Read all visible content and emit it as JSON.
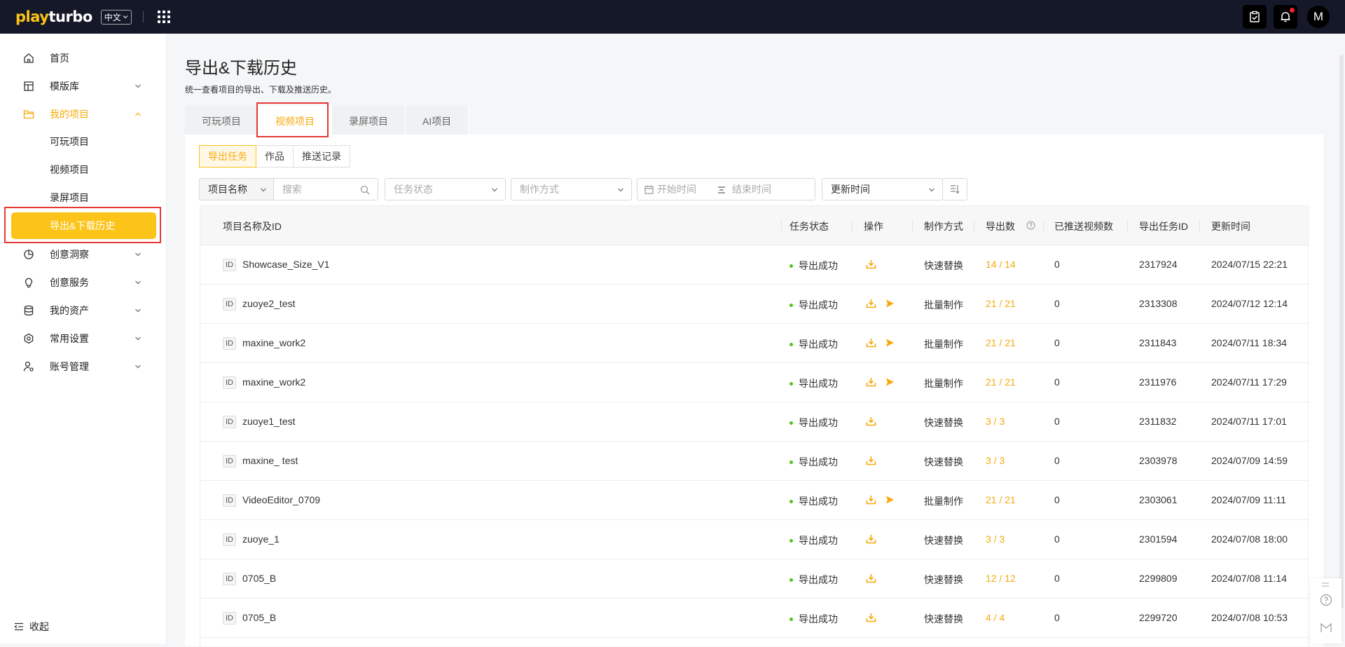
{
  "topbar": {
    "logo_prefix": "play",
    "logo_suffix": "turbo",
    "lang": "中文",
    "avatar": "M",
    "icons": [
      "apps-grid-icon",
      "clipboard-check-icon",
      "bell-icon"
    ]
  },
  "sidebar": {
    "home": "首页",
    "templates": "模版库",
    "my_projects": "我的项目",
    "sub_playable": "可玩项目",
    "sub_video": "视频项目",
    "sub_record": "录屏项目",
    "sub_history": "导出&下载历史",
    "insights": "创意洞察",
    "services": "创意服务",
    "assets": "我的资产",
    "settings": "常用设置",
    "account": "账号管理",
    "collapse": "收起"
  },
  "page": {
    "title": "导出&下载历史",
    "subtitle": "统一查看项目的导出、下载及推送历史。"
  },
  "tabs": [
    "可玩项目",
    "视频项目",
    "录屏项目",
    "AI项目"
  ],
  "segments": [
    "导出任务",
    "作品",
    "推送记录"
  ],
  "filters": {
    "name_select": "项目名称",
    "search_placeholder": "搜索",
    "status_placeholder": "任务状态",
    "method_placeholder": "制作方式",
    "start_placeholder": "开始时间",
    "end_placeholder": "结束时间",
    "sort_select": "更新时间"
  },
  "table": {
    "headers": [
      "项目名称及ID",
      "任务状态",
      "操作",
      "制作方式",
      "导出数",
      "已推送视频数",
      "导出任务ID",
      "更新时间"
    ],
    "id_tag": "ID",
    "rows": [
      {
        "name": "Showcase_Size_V1",
        "status": "导出成功",
        "push": false,
        "method": "快速替换",
        "count": "14 / 14",
        "pushed": "0",
        "task_id": "2317924",
        "time": "2024/07/15 22:21"
      },
      {
        "name": "zuoye2_test",
        "status": "导出成功",
        "push": true,
        "method": "批量制作",
        "count": "21 / 21",
        "pushed": "0",
        "task_id": "2313308",
        "time": "2024/07/12 12:14"
      },
      {
        "name": "maxine_work2",
        "status": "导出成功",
        "push": true,
        "method": "批量制作",
        "count": "21 / 21",
        "pushed": "0",
        "task_id": "2311843",
        "time": "2024/07/11 18:34"
      },
      {
        "name": "maxine_work2",
        "status": "导出成功",
        "push": true,
        "method": "批量制作",
        "count": "21 / 21",
        "pushed": "0",
        "task_id": "2311976",
        "time": "2024/07/11 17:29"
      },
      {
        "name": "zuoye1_test",
        "status": "导出成功",
        "push": false,
        "method": "快速替换",
        "count": "3 / 3",
        "pushed": "0",
        "task_id": "2311832",
        "time": "2024/07/11 17:01"
      },
      {
        "name": "maxine_ test",
        "status": "导出成功",
        "push": false,
        "method": "快速替换",
        "count": "3 / 3",
        "pushed": "0",
        "task_id": "2303978",
        "time": "2024/07/09 14:59"
      },
      {
        "name": "VideoEditor_0709",
        "status": "导出成功",
        "push": true,
        "method": "批量制作",
        "count": "21 / 21",
        "pushed": "0",
        "task_id": "2303061",
        "time": "2024/07/09 11:11"
      },
      {
        "name": "zuoye_1",
        "status": "导出成功",
        "push": false,
        "method": "快速替换",
        "count": "3 / 3",
        "pushed": "0",
        "task_id": "2301594",
        "time": "2024/07/08 18:00"
      },
      {
        "name": "0705_B",
        "status": "导出成功",
        "push": false,
        "method": "快速替换",
        "count": "12 / 12",
        "pushed": "0",
        "task_id": "2299809",
        "time": "2024/07/08 11:14"
      },
      {
        "name": "0705_B",
        "status": "导出成功",
        "push": false,
        "method": "快速替换",
        "count": "4 / 4",
        "pushed": "0",
        "task_id": "2299720",
        "time": "2024/07/08 10:53"
      }
    ]
  },
  "colors": {
    "accent": "#fcc419",
    "accent_text": "#f7a90c",
    "topbar": "#141829",
    "success": "#52c41a",
    "highlight_box": "#e53935"
  }
}
